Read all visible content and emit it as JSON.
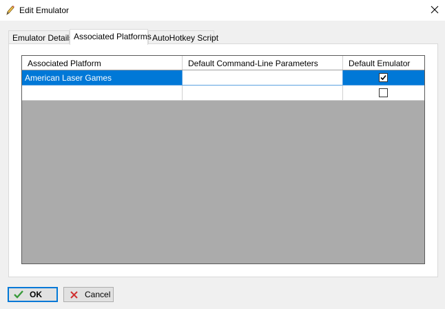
{
  "window": {
    "title": "Edit Emulator",
    "title_icon": "pencil-icon",
    "close_icon": "close-icon"
  },
  "tabs": [
    {
      "label": "Emulator Details",
      "active": false
    },
    {
      "label": "Associated Platforms",
      "active": true
    },
    {
      "label": "AutoHotkey Script",
      "active": false
    }
  ],
  "grid": {
    "columns": [
      "Associated Platform",
      "Default Command-Line Parameters",
      "Default Emulator"
    ],
    "rows": [
      {
        "platform": "American Laser Games",
        "params": "",
        "default_emulator": true,
        "selected": true
      },
      {
        "platform": "",
        "params": "",
        "default_emulator": false,
        "selected": false
      }
    ]
  },
  "buttons": {
    "ok_label": "OK",
    "ok_icon": "checkmark-icon",
    "cancel_label": "Cancel",
    "cancel_icon": "x-icon"
  },
  "colors": {
    "selection": "#0078d7",
    "grid_background": "#ababab",
    "ok_icon": "#3a9a3a",
    "cancel_icon": "#d03030"
  }
}
